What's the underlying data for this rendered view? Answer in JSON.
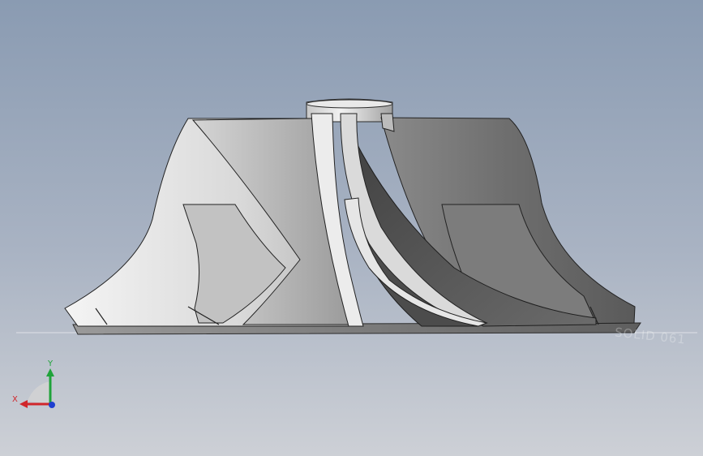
{
  "viewport": {
    "background_top": "#8b9cb3",
    "background_bottom": "#c9cdd4",
    "model_icon": "impeller-model"
  },
  "watermark": {
    "text": "SOLID 061"
  },
  "triad": {
    "x_label": "X",
    "y_label": "Y",
    "x_color": "#d0262b",
    "y_color": "#1fa33a",
    "z_color": "#1e3fd0"
  }
}
